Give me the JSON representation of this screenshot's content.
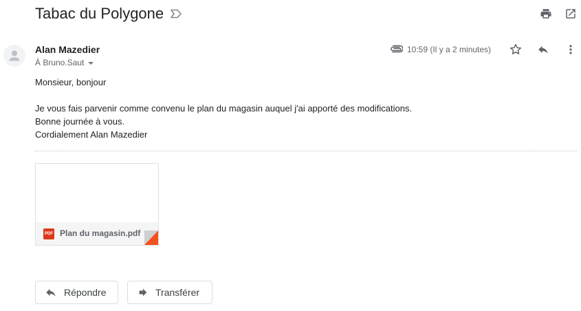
{
  "email": {
    "subject": "Tabac du Polygone",
    "sender": "Alan Mazedier",
    "recipient": "À Bruno.Saut",
    "time": "10:59 (Il y a 2 minutes)",
    "body": [
      "Monsieur, bonjour",
      "Je vous fais parvenir comme convenu le plan du magasin auquel j'ai apporté des modifications.",
      "Bonne journée à vous.",
      "Cordialement Alan Mazedier"
    ],
    "attachment": {
      "badge": "PDF",
      "name": "Plan du magasin.pdf"
    }
  },
  "actions": {
    "reply_label": "Répondre",
    "forward_label": "Transférer"
  },
  "icons": [
    "label-icon",
    "print-icon",
    "open-in-new-window-icon",
    "avatar-icon",
    "paperclip-icon",
    "star-icon",
    "reply-icon",
    "more-vert-icon",
    "pdf-icon",
    "forward-icon"
  ],
  "colors": {
    "pdf_red": "#db3a1c",
    "icon_gray": "#5f6368",
    "corner_orange": "#f4511e"
  }
}
